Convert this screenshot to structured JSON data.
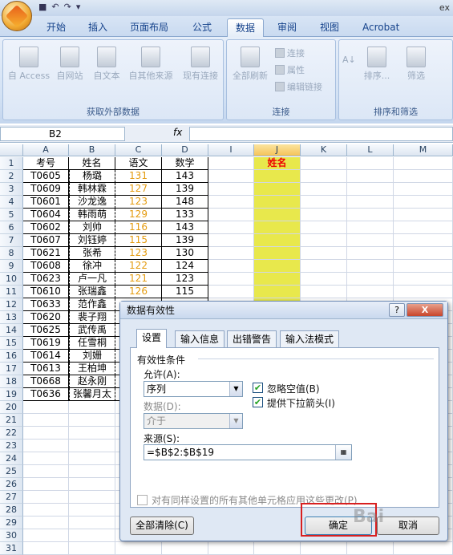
{
  "title_partial": "ex",
  "tabs": [
    "开始",
    "插入",
    "页面布局",
    "公式",
    "数据",
    "审阅",
    "视图",
    "Acrobat"
  ],
  "active_tab": "数据",
  "ribbon": {
    "group1": {
      "label": "获取外部数据",
      "buttons": [
        "自 Access",
        "自网站",
        "自文本",
        "自其他来源",
        "现有连接"
      ]
    },
    "group2": {
      "label": "连接",
      "refresh": "全部刷新",
      "small": [
        "连接",
        "属性",
        "编辑链接"
      ]
    },
    "group3": {
      "label": "排序和筛选",
      "sort": "排序...",
      "filter": "筛选"
    }
  },
  "namebox": "B2",
  "fx": "fx",
  "columns": [
    "A",
    "B",
    "C",
    "D",
    "I",
    "J",
    "K",
    "L",
    "M"
  ],
  "headers": {
    "a": "考号",
    "b": "姓名",
    "c": "语文",
    "d": "数学",
    "j": "姓名"
  },
  "rows": [
    [
      "T0605",
      "杨璐",
      "131",
      "143"
    ],
    [
      "T0609",
      "韩林霖",
      "127",
      "139"
    ],
    [
      "T0601",
      "沙龙逸",
      "123",
      "148"
    ],
    [
      "T0604",
      "韩雨萌",
      "129",
      "133"
    ],
    [
      "T0602",
      "刘帅",
      "116",
      "143"
    ],
    [
      "T0607",
      "刘钰婷",
      "115",
      "139"
    ],
    [
      "T0621",
      "张希",
      "123",
      "130"
    ],
    [
      "T0608",
      "徐冲",
      "122",
      "124"
    ],
    [
      "T0623",
      "卢一凡",
      "121",
      "123"
    ],
    [
      "T0610",
      "张瑞鑫",
      "126",
      "115"
    ],
    [
      "T0633",
      "范作鑫",
      "",
      ""
    ],
    [
      "T0620",
      "裴子翔",
      "",
      ""
    ],
    [
      "T0625",
      "武传禹",
      "",
      ""
    ],
    [
      "T0619",
      "任雪桐",
      "",
      ""
    ],
    [
      "T0614",
      "刘姗",
      "",
      ""
    ],
    [
      "T0613",
      "王柏坤",
      "",
      ""
    ],
    [
      "T0668",
      "赵永刚",
      "",
      ""
    ],
    [
      "T0636",
      "张馨月太",
      "",
      ""
    ]
  ],
  "row_numbers": [
    "1",
    "2",
    "3",
    "4",
    "5",
    "6",
    "7",
    "8",
    "9",
    "10",
    "11",
    "12",
    "13",
    "14",
    "15",
    "16",
    "17",
    "18",
    "19",
    "20",
    "21",
    "22",
    "23",
    "24",
    "25",
    "26",
    "27",
    "28",
    "29",
    "30",
    "31"
  ],
  "dialog": {
    "title": "数据有效性",
    "help": "?",
    "close": "X",
    "tabs": [
      "设置",
      "输入信息",
      "出错警告",
      "输入法模式"
    ],
    "section": "有效性条件",
    "allow_label": "允许(A):",
    "allow_value": "序列",
    "data_label": "数据(D):",
    "data_value": "介于",
    "ignore_blank": "忽略空值(B)",
    "dropdown": "提供下拉箭头(I)",
    "source_label": "来源(S):",
    "source_value": "=$B$2:$B$19",
    "apply_all": "对有同样设置的所有其他单元格应用这些更改(P)",
    "clear_all": "全部清除(C)",
    "ok": "确定",
    "cancel": "取消"
  },
  "watermark": "Bai"
}
